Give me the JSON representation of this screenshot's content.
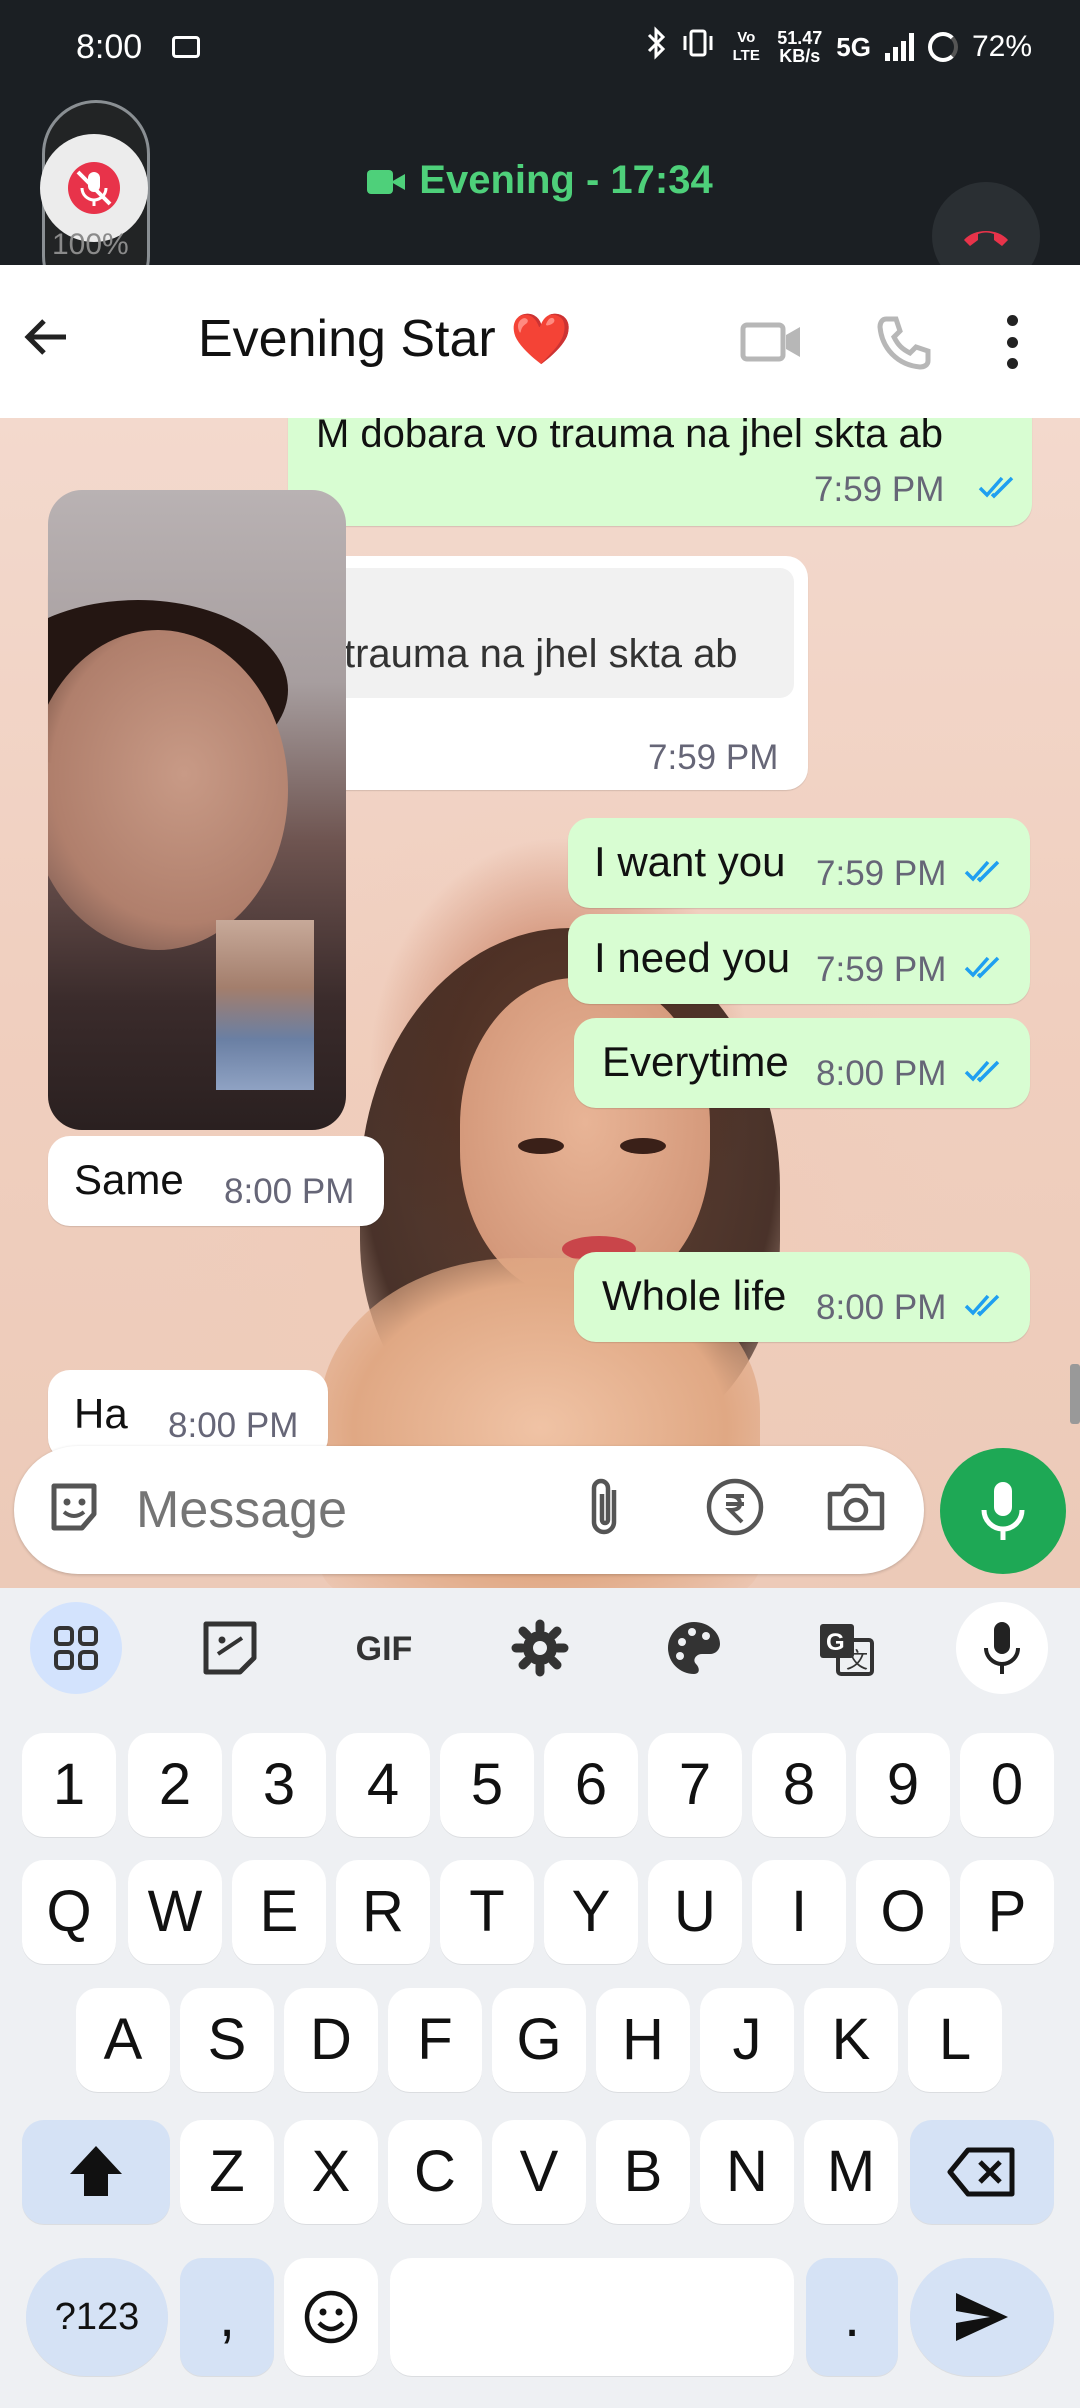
{
  "status_bar": {
    "time": "8:00",
    "net_speed_top": "51.47",
    "net_speed_bottom": "KB/s",
    "network": "5G",
    "volte": "Vo LTE",
    "battery": "72%"
  },
  "call": {
    "title": "Evening - 17:34",
    "volume_percent": "100%",
    "accent_color": "#4ed07a",
    "hangup_color": "#e8334a"
  },
  "header": {
    "contact_name": "Evening Star",
    "emoji": "❤️"
  },
  "messages": [
    {
      "dir": "out",
      "text": "M dobara vo trauma na jhel skta ab",
      "time": "7:59 PM",
      "read": true
    },
    {
      "dir": "in",
      "text": "trauma na jhel skta ab",
      "time": "7:59 PM"
    },
    {
      "dir": "out",
      "text": "I want you",
      "time": "7:59 PM",
      "read": true
    },
    {
      "dir": "out",
      "text": "I need you",
      "time": "7:59 PM",
      "read": true
    },
    {
      "dir": "out",
      "text": "Everytime",
      "time": "8:00 PM",
      "read": true
    },
    {
      "dir": "in",
      "text": "Same",
      "time": "8:00 PM"
    },
    {
      "dir": "out",
      "text": "Whole life",
      "time": "8:00 PM",
      "read": true
    },
    {
      "dir": "in",
      "text": "Ha",
      "time": "8:00 PM"
    }
  ],
  "composer": {
    "placeholder": "Message"
  },
  "keyboard": {
    "toolbar": [
      "apps-icon",
      "sticker-icon",
      "GIF",
      "settings-icon",
      "palette-icon",
      "translate-icon",
      "mic-icon"
    ],
    "gif_label": "GIF",
    "row_numbers": [
      "1",
      "2",
      "3",
      "4",
      "5",
      "6",
      "7",
      "8",
      "9",
      "0"
    ],
    "row_top": [
      "Q",
      "W",
      "E",
      "R",
      "T",
      "Y",
      "U",
      "I",
      "O",
      "P"
    ],
    "row_mid": [
      "A",
      "S",
      "D",
      "F",
      "G",
      "H",
      "J",
      "K",
      "L"
    ],
    "row_bottom": [
      "Z",
      "X",
      "C",
      "V",
      "B",
      "N",
      "M"
    ],
    "symbols_label": "?123",
    "comma": ",",
    "period": "."
  }
}
